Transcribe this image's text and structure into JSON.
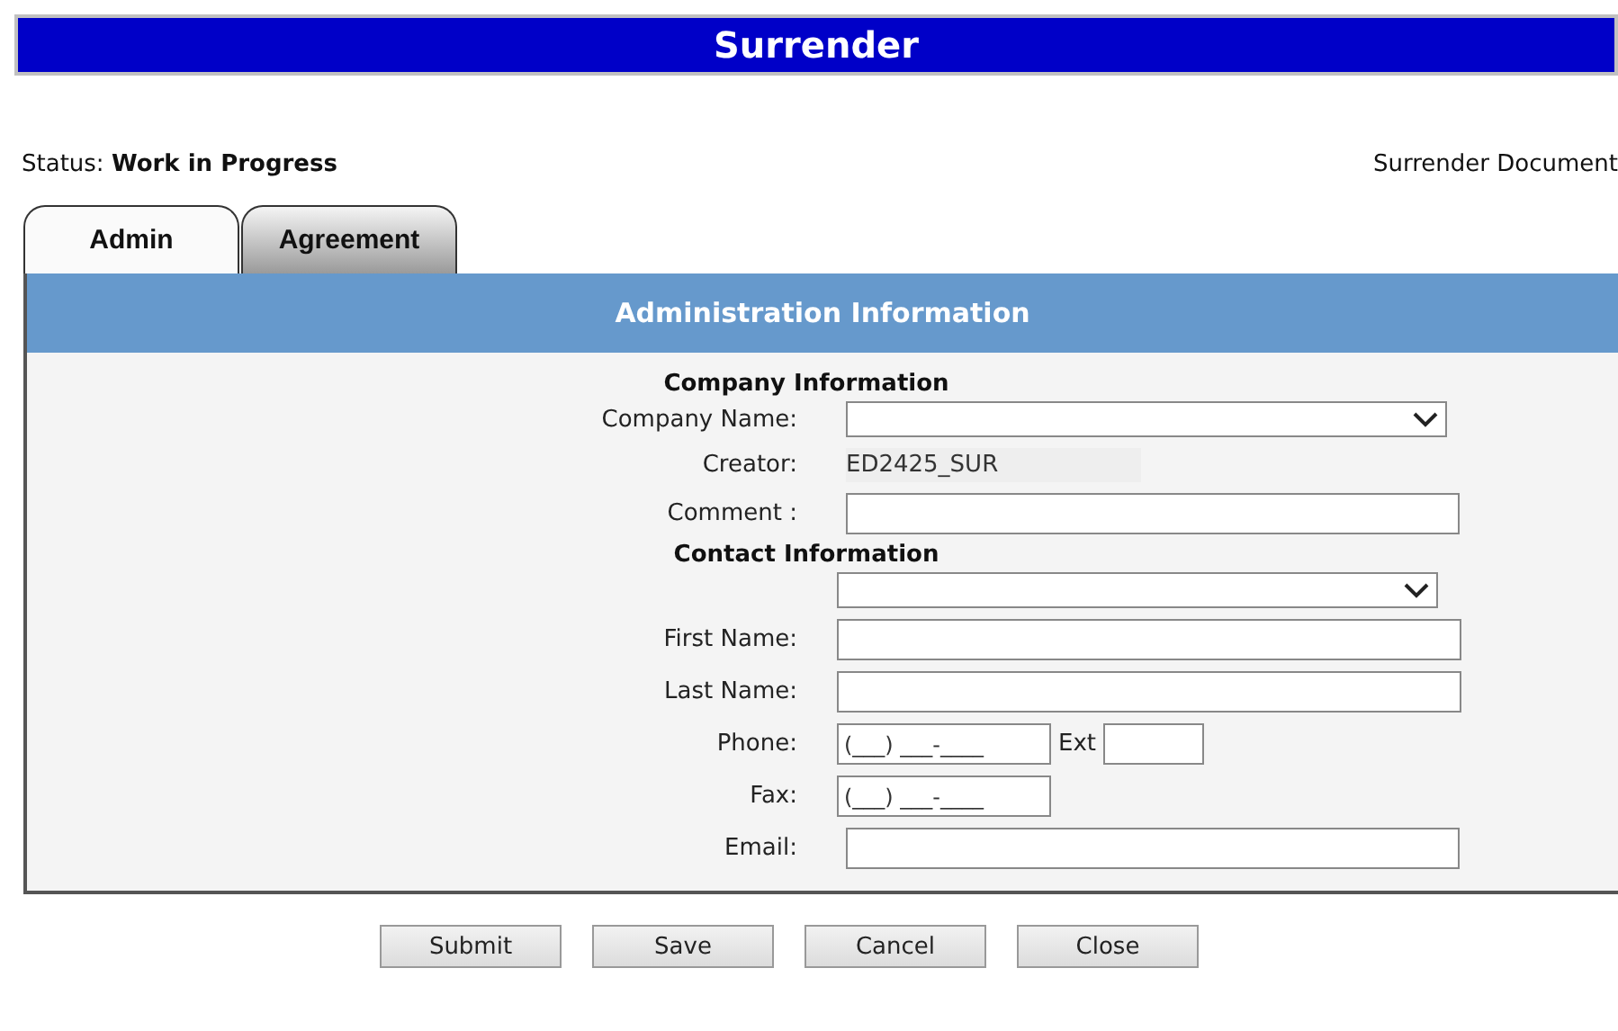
{
  "title": "Surrender",
  "status": {
    "label": "Status:",
    "value": "Work in Progress"
  },
  "document_link": "Surrender Document",
  "tabs": [
    {
      "label": "Admin",
      "selected": true
    },
    {
      "label": "Agreement",
      "selected": false
    }
  ],
  "panel_title": "Administration Information",
  "rows": [
    {
      "kind": "heading",
      "label": "Company Information"
    },
    {
      "kind": "select",
      "label": "Company Name:",
      "value": ""
    },
    {
      "kind": "static",
      "label": "Creator:",
      "value": "ED2425_SUR"
    },
    {
      "kind": "input",
      "label": "Comment :",
      "value": ""
    },
    {
      "kind": "heading",
      "label": "Contact Information"
    },
    {
      "kind": "select",
      "label": "",
      "value": ""
    },
    {
      "kind": "input",
      "label": "First Name:",
      "value": ""
    },
    {
      "kind": "input",
      "label": "Last Name:",
      "value": ""
    },
    {
      "kind": "phone",
      "label": "Phone:",
      "value": "(___) ___-____",
      "ext_label": "Ext"
    },
    {
      "kind": "phone",
      "label": "Fax:",
      "value": "(___) ___-____"
    },
    {
      "kind": "input",
      "label": "Email:",
      "value": ""
    }
  ],
  "buttons": [
    "Submit",
    "Save",
    "Cancel",
    "Close"
  ]
}
